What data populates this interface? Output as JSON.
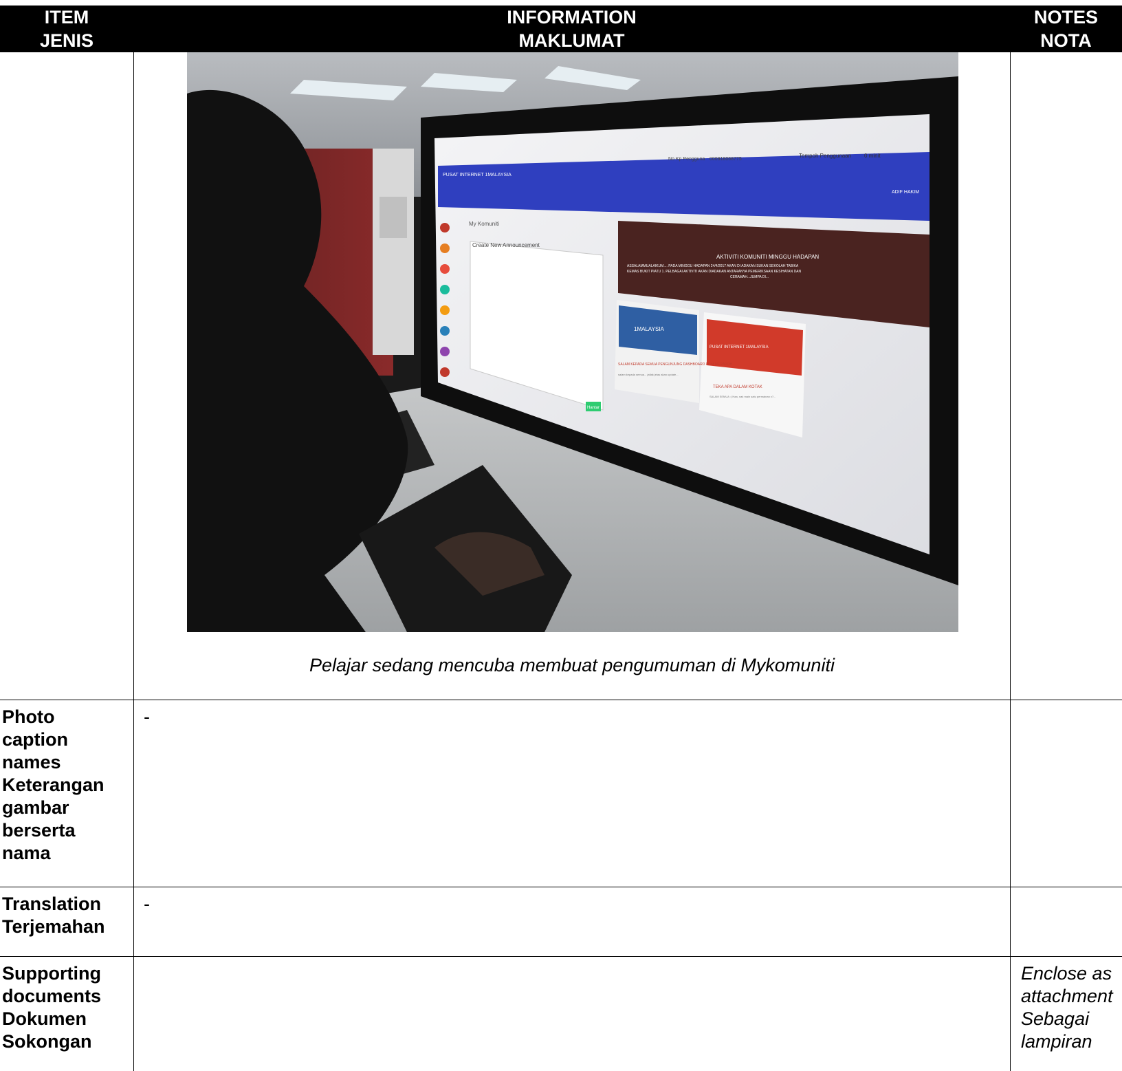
{
  "header": {
    "item_en": "ITEM",
    "item_ms": "JENIS",
    "info_en": "INFORMATION",
    "info_ms": "MAKLUMAT",
    "notes_en": "NOTES",
    "notes_ms": "NOTA"
  },
  "photo_row": {
    "caption": "Pelajar sedang mencuba membuat pengumuman di Mykomuniti",
    "screen": {
      "user_label": "No Kp Pengguna",
      "user_value": "000918068775",
      "usage_label": "Tempoh Penggunaan",
      "usage_value": "0 minit",
      "logo": "PUSAT INTERNET 1MALAYSIA",
      "user_name": "ADIF HAKIM",
      "breadcrumb": "My Komuniti",
      "form_title": "Create New Announcement",
      "submit_label": "Hantar",
      "banner_title": "AKTIVITI KOMUNITI MINGGU HADAPAN",
      "banner_line1": "ASSALAMMUALAIKUM.... PADA MINGGU HADAPAN 24/4/2017 AKAN DI ADAKAN SUKAN SEKOLAH TABIKA",
      "banner_line2": "KEMAS BUKIT PIATU 1. PELBAGAI AKTIVITI AKAN DIADAKAN ANTARANYA PEMERIKSAAN KESIHATAN DAN",
      "banner_line3": "CERAMAH...JUMPA DI...",
      "card1_sign": "1MALAYSIA",
      "card1_title": "SALAM KEPADA SEMUA PENGUNJUNG DASHBOARD PI1M MERAPOH",
      "card1_text": "salam kepada semua... jafiak jelas akan update...",
      "card2_sign": "PUSAT INTERNET 1MALAYSIA",
      "card2_title": "TEKA APA DALAM KOTAK",
      "card2_text": "SALAM SEMUA :) Haa, nak main satu permainan x?..."
    }
  },
  "rows": [
    {
      "label": "Photo caption names Keterangan gambar berserta nama",
      "value": "-",
      "note": ""
    },
    {
      "label": "Translation Terjemahan",
      "value": "-",
      "note": ""
    },
    {
      "label": "Supporting documents Dokumen Sokongan",
      "value": "",
      "note": "Enclose as attachment Sebagai lampiran"
    }
  ],
  "labels": {
    "row1": [
      "Photo",
      "caption",
      "names",
      "Keterangan",
      "gambar",
      "berserta",
      "nama"
    ],
    "row2": [
      "Translation",
      "Terjemahan"
    ],
    "row3": [
      "Supporting",
      "documents",
      "Dokumen",
      "Sokongan"
    ],
    "note3": [
      "Enclose as",
      "attachment",
      "Sebagai",
      "lampiran"
    ]
  }
}
